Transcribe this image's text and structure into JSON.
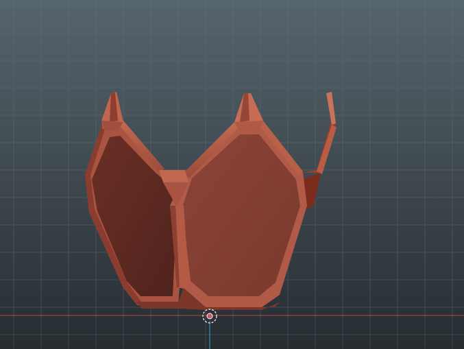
{
  "viewport": {
    "colors": {
      "background_top": "#56646c",
      "background_bottom": "#262c30",
      "grid_line": "#6a787f",
      "ground_axis_x": "#b8423f",
      "ground_axis_z": "#3f9fd0",
      "model_base": "#8a4033",
      "model_light": "#b5604b",
      "model_dark": "#5a271f"
    }
  },
  "model": {
    "name": "faceted-bowl-mesh"
  },
  "gizmo": {
    "icon": "pivot-target-icon"
  }
}
